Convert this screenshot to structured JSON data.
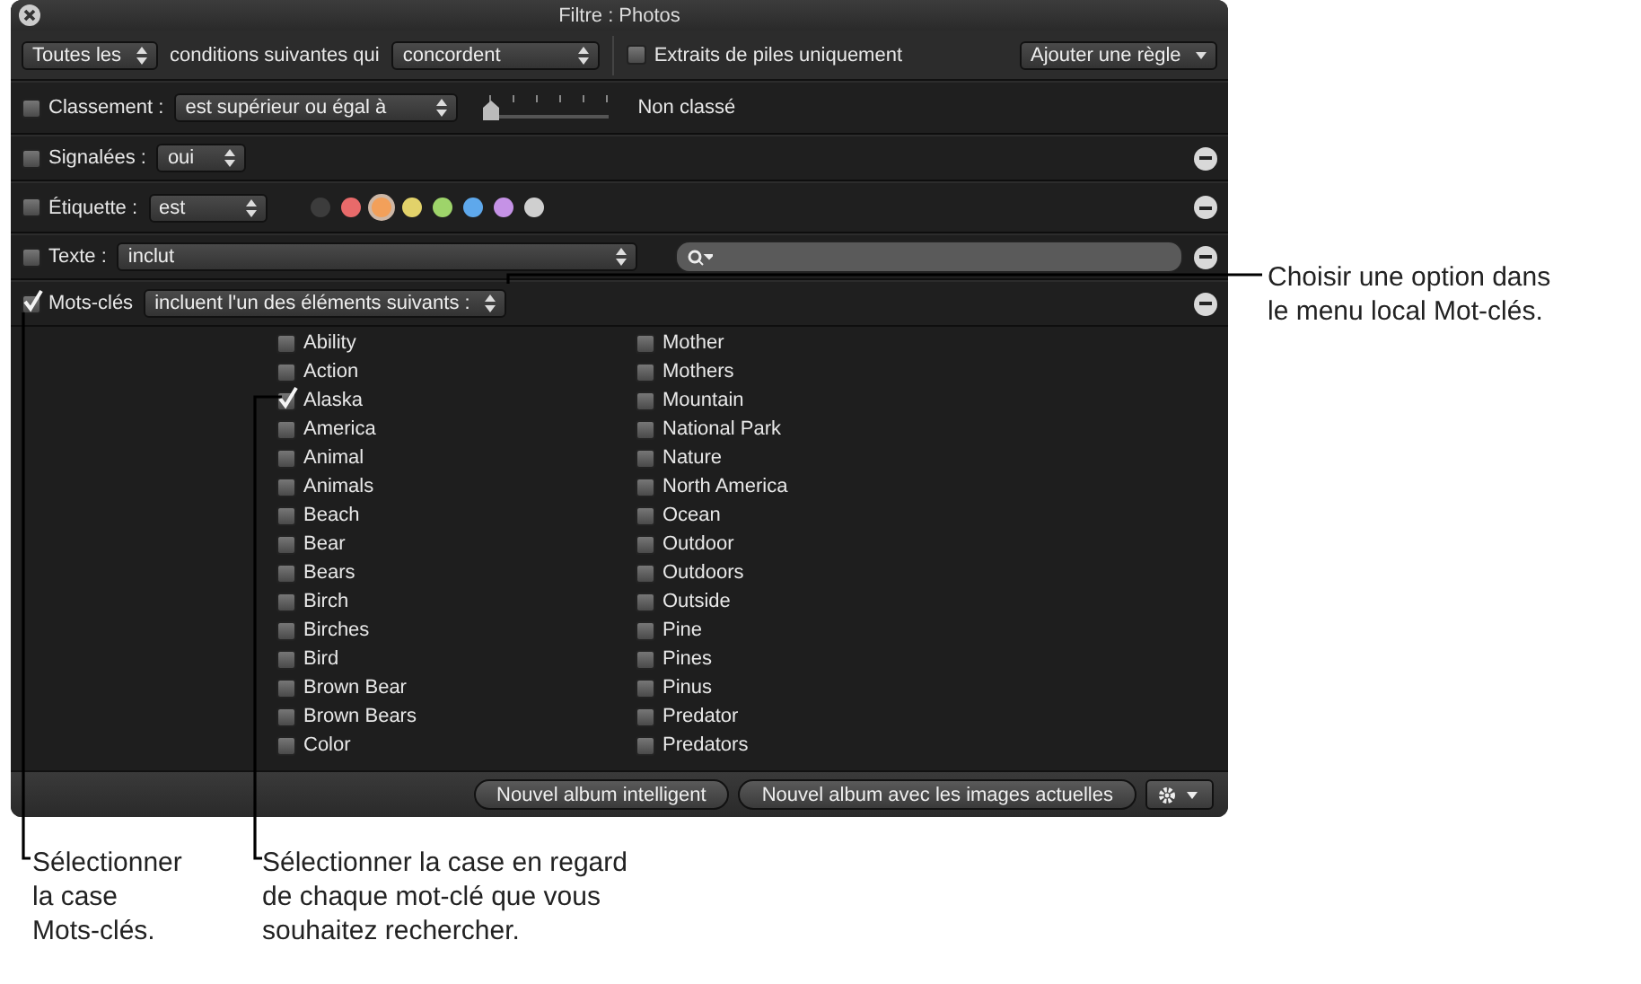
{
  "window": {
    "title": "Filtre : Photos"
  },
  "toolbar": {
    "scope_popup": "Toutes les",
    "scope_text": "conditions suivantes qui",
    "match_popup": "concordent",
    "stacks_checkbox": {
      "label": "Extraits de piles uniquement",
      "checked": false
    },
    "add_rule_button": "Ajouter une règle"
  },
  "rules": [
    {
      "kind": "rating",
      "checked": false,
      "label": "Classement :",
      "popup": "est supérieur ou égal à",
      "level": 0,
      "reading": "Non classé",
      "removable": false
    },
    {
      "kind": "flagged",
      "checked": false,
      "label": "Signalées :",
      "popup": "oui",
      "removable": true
    },
    {
      "kind": "colorlabel",
      "checked": false,
      "label": "Étiquette :",
      "popup": "est",
      "removable": true,
      "colors": [
        {
          "color": "#3c3c3c",
          "selected": false
        },
        {
          "color": "#e86a6a",
          "selected": false
        },
        {
          "color": "#f2a05a",
          "selected": true
        },
        {
          "color": "#e2d26a",
          "selected": false
        },
        {
          "color": "#9ed46a",
          "selected": false
        },
        {
          "color": "#5ea8ec",
          "selected": false
        },
        {
          "color": "#c592e6",
          "selected": false
        },
        {
          "color": "#cfcfcf",
          "selected": false
        }
      ]
    },
    {
      "kind": "text",
      "checked": false,
      "label": "Texte :",
      "popup": "inclut",
      "removable": true
    },
    {
      "kind": "keywords",
      "checked": true,
      "label": "Mots-clés",
      "popup": "incluent l'un des éléments suivants :",
      "removable": true,
      "columns": [
        [
          {
            "label": "Ability",
            "checked": false
          },
          {
            "label": "Action",
            "checked": false
          },
          {
            "label": "Alaska",
            "checked": true
          },
          {
            "label": "America",
            "checked": false
          },
          {
            "label": "Animal",
            "checked": false
          },
          {
            "label": "Animals",
            "checked": false
          },
          {
            "label": "Beach",
            "checked": false
          },
          {
            "label": "Bear",
            "checked": false
          },
          {
            "label": "Bears",
            "checked": false
          },
          {
            "label": "Birch",
            "checked": false
          },
          {
            "label": "Birches",
            "checked": false
          },
          {
            "label": "Bird",
            "checked": false
          },
          {
            "label": "Brown Bear",
            "checked": false
          },
          {
            "label": "Brown Bears",
            "checked": false
          },
          {
            "label": "Color",
            "checked": false
          }
        ],
        [
          {
            "label": "Mother",
            "checked": false
          },
          {
            "label": "Mothers",
            "checked": false
          },
          {
            "label": "Mountain",
            "checked": false
          },
          {
            "label": "National Park",
            "checked": false
          },
          {
            "label": "Nature",
            "checked": false
          },
          {
            "label": "North America",
            "checked": false
          },
          {
            "label": "Ocean",
            "checked": false
          },
          {
            "label": "Outdoor",
            "checked": false
          },
          {
            "label": "Outdoors",
            "checked": false
          },
          {
            "label": "Outside",
            "checked": false
          },
          {
            "label": "Pine",
            "checked": false
          },
          {
            "label": "Pines",
            "checked": false
          },
          {
            "label": "Pinus",
            "checked": false
          },
          {
            "label": "Predator",
            "checked": false
          },
          {
            "label": "Predators",
            "checked": false
          }
        ]
      ]
    }
  ],
  "bottom_bar": {
    "buttons": [
      "Nouvel album intelligent",
      "Nouvel album avec les images actuelles"
    ]
  },
  "callouts": [
    {
      "text": "Choisir une option dans\nle menu local Mot-clés."
    },
    {
      "text": "Sélectionner\nla case\nMots-clés."
    },
    {
      "text": "Sélectionner la case en regard\nde chaque mot-clé que vous\nsouhaitez rechercher."
    }
  ]
}
